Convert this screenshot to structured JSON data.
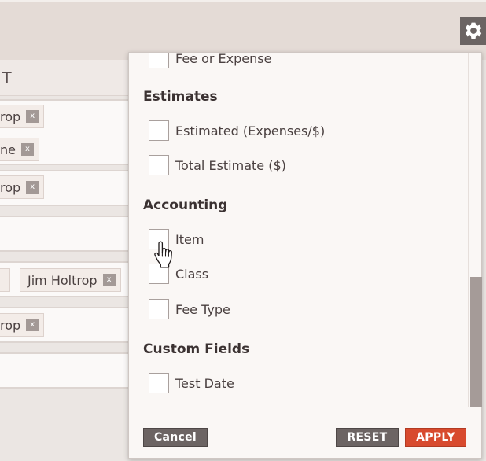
{
  "background_table": {
    "header_label": "T",
    "rows": [
      {
        "tags": [
          "rop",
          "ne"
        ]
      },
      {
        "tags": [
          "rop"
        ]
      },
      {
        "tags": []
      },
      {
        "tags": [
          "",
          "Jim Holtrop"
        ]
      },
      {
        "tags": [
          "rop"
        ]
      },
      {
        "tags": []
      }
    ],
    "tag_remove_label": "x"
  },
  "filter_panel": {
    "partial_option_label": "Fee or Expense",
    "sections": [
      {
        "title": "Estimates",
        "options": [
          "Estimated (Expenses/$)",
          "Total Estimate ($)"
        ]
      },
      {
        "title": "Accounting",
        "options": [
          "Item",
          "Class",
          "Fee Type"
        ]
      },
      {
        "title": "Custom Fields",
        "options": [
          "Test Date"
        ]
      }
    ],
    "footer": {
      "cancel_label": "Cancel",
      "reset_label": "RESET",
      "apply_label": "APPLY"
    }
  },
  "colors": {
    "apply_accent": "#d84a2e",
    "button_dark": "#6c6463",
    "panel_bg": "#faf7f5"
  },
  "icons": {
    "settings": "gear-icon",
    "pointer": "hand-cursor-icon"
  }
}
